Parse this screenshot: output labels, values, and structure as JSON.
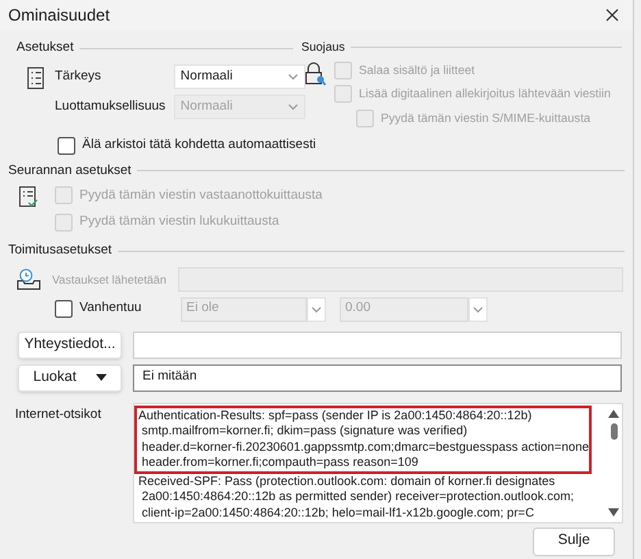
{
  "window": {
    "title": "Ominaisuudet"
  },
  "settings": {
    "heading": "Asetukset",
    "importance": {
      "label": "Tärkeys",
      "value": "Normaali",
      "disabled": false
    },
    "sensitivity": {
      "label": "Luottamuksellisuus",
      "value": "Normaali",
      "disabled": true
    },
    "no_autoarchive": {
      "label": "Älä arkistoi tätä kohdetta automaattisesti",
      "checked": false,
      "disabled": false
    }
  },
  "security": {
    "heading": "Suojaus",
    "options": [
      {
        "label": "Salaa sisältö ja liitteet",
        "checked": false,
        "disabled": true
      },
      {
        "label": "Lisää digitaalinen allekirjoitus lähtevään viestiin",
        "checked": false,
        "disabled": true,
        "children": [
          {
            "label": "Pyydä tämän viestin S/MIME-kuittausta",
            "checked": false,
            "disabled": true
          }
        ]
      }
    ]
  },
  "tracking": {
    "heading": "Seurannan asetukset",
    "options": [
      {
        "label": "Pyydä tämän viestin vastaanottokuittausta",
        "checked": false,
        "disabled": true
      },
      {
        "label": "Pyydä tämän viestin lukukuittausta",
        "checked": false,
        "disabled": true
      }
    ]
  },
  "delivery": {
    "heading": "Toimitusasetukset",
    "replies_to": {
      "label": "Vastaukset lähetetään",
      "disabled": true
    },
    "expires": {
      "label": "Vanhentuu",
      "checked": false,
      "disabled": false,
      "date": "Ei ole",
      "time": "0.00",
      "fields_disabled": true
    }
  },
  "contacts": {
    "button": "Yhteystiedot..."
  },
  "categories": {
    "button": "Luokat",
    "value": "Ei mitään"
  },
  "internet_headers": {
    "label": "Internet-otsikot",
    "lines": [
      {
        "text": "Authentication-Results: spf=pass (sender IP is 2a00:1450:4864:20::12b)",
        "highlighted": true
      },
      {
        "text": " smtp.mailfrom=korner.fi; dkim=pass (signature was verified)",
        "highlighted": true
      },
      {
        "text": " header.d=korner-fi.20230601.gappssmtp.com;dmarc=bestguesspass action=none",
        "highlighted": true
      },
      {
        "text": " header.from=korner.fi;compauth=pass reason=109",
        "highlighted": true
      },
      {
        "text": "Received-SPF: Pass (protection.outlook.com: domain of korner.fi designates",
        "highlighted": false
      },
      {
        "text": " 2a00:1450:4864:20::12b as permitted sender) receiver=protection.outlook.com;",
        "highlighted": false
      },
      {
        "text": " client-ip=2a00:1450:4864:20::12b; helo=mail-lf1-x12b.google.com; pr=C",
        "highlighted": false
      }
    ]
  },
  "close_button": "Sulje"
}
